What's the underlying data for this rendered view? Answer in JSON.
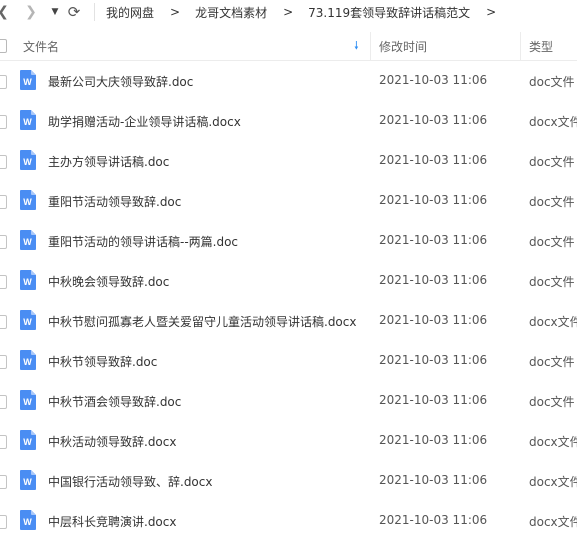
{
  "nav": {
    "back_icon": "chevron-left-icon",
    "forward_icon": "chevron-right-icon",
    "dropdown_icon": "caret-down-icon",
    "refresh_icon": "refresh-icon"
  },
  "breadcrumb": {
    "items": [
      "我的网盘",
      "龙哥文档素材",
      "73.119套领导致辞讲话稿范文"
    ],
    "separator": ">"
  },
  "columns": {
    "name": "文件名",
    "modified": "修改时间",
    "type": "类型"
  },
  "colors": {
    "accent": "#2f8ef4",
    "doc_icon": "#4a8df3"
  },
  "files": [
    {
      "name": "最新公司大庆领导致辞.doc",
      "modified": "2021-10-03 11:06",
      "type": "doc文件"
    },
    {
      "name": "助学捐赠活动-企业领导讲话稿.docx",
      "modified": "2021-10-03 11:06",
      "type": "docx文件"
    },
    {
      "name": "主办方领导讲话稿.doc",
      "modified": "2021-10-03 11:06",
      "type": "doc文件"
    },
    {
      "name": "重阳节活动领导致辞.doc",
      "modified": "2021-10-03 11:06",
      "type": "doc文件"
    },
    {
      "name": "重阳节活动的领导讲话稿--两篇.doc",
      "modified": "2021-10-03 11:06",
      "type": "doc文件"
    },
    {
      "name": "中秋晚会领导致辞.doc",
      "modified": "2021-10-03 11:06",
      "type": "doc文件"
    },
    {
      "name": "中秋节慰问孤寡老人暨关爱留守儿童活动领导讲话稿.docx",
      "modified": "2021-10-03 11:06",
      "type": "docx文件"
    },
    {
      "name": "中秋节领导致辞.doc",
      "modified": "2021-10-03 11:06",
      "type": "doc文件"
    },
    {
      "name": "中秋节酒会领导致辞.doc",
      "modified": "2021-10-03 11:06",
      "type": "doc文件"
    },
    {
      "name": "中秋活动领导致辞.docx",
      "modified": "2021-10-03 11:06",
      "type": "docx文件"
    },
    {
      "name": "中国银行活动领导致、辞.docx",
      "modified": "2021-10-03 11:06",
      "type": "docx文件"
    },
    {
      "name": "中层科长竞聘演讲.docx",
      "modified": "2021-10-03 11:06",
      "type": "docx文件"
    }
  ]
}
